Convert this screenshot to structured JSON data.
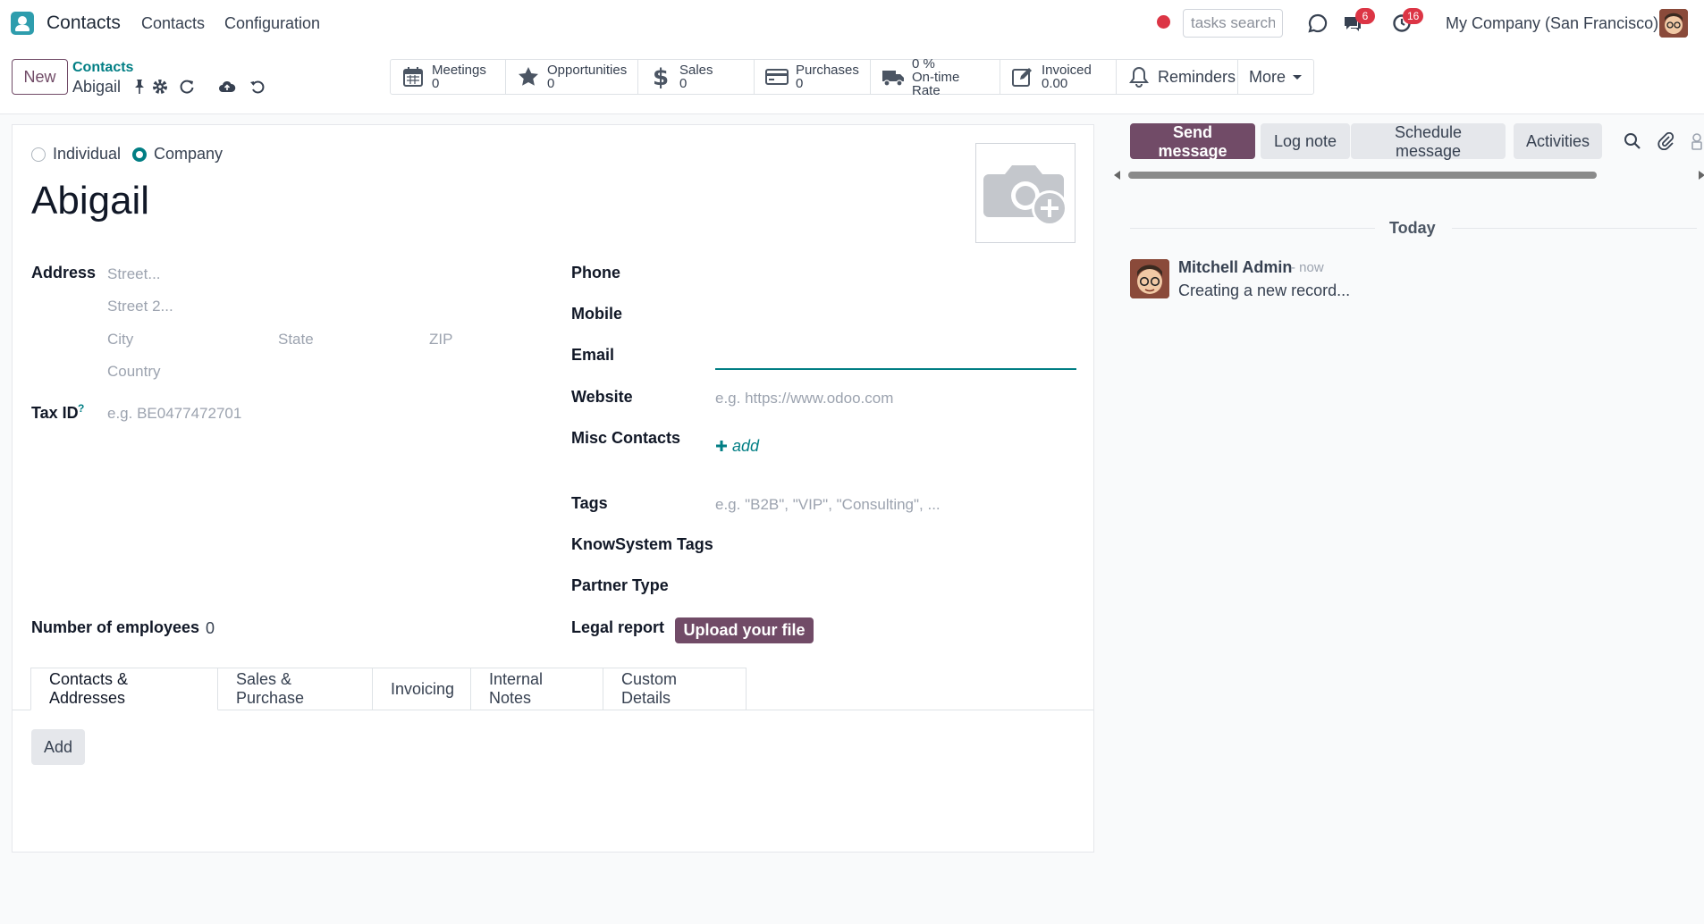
{
  "topbar": {
    "app_name": "Contacts",
    "menu": [
      "Contacts",
      "Configuration"
    ],
    "search_placeholder": "tasks search",
    "messages_count": "6",
    "activities_count": "16",
    "company": "My Company (San Francisco)"
  },
  "control": {
    "new_label": "New",
    "breadcrumb_parent": "Contacts",
    "breadcrumb_current": "Abigail"
  },
  "smart_buttons": {
    "meetings": {
      "label": "Meetings",
      "value": "0"
    },
    "opportunities": {
      "label": "Opportunities",
      "value": "0"
    },
    "sales": {
      "label": "Sales",
      "value": "0"
    },
    "purchases": {
      "label": "Purchases",
      "value": "0"
    },
    "ontime": {
      "value": "0 %",
      "label": "On-time Rate"
    },
    "invoiced": {
      "label": "Invoiced",
      "value": "0.00"
    },
    "reminders": "Reminders",
    "more": "More"
  },
  "form": {
    "type_individual": "Individual",
    "type_company": "Company",
    "name": "Abigail",
    "address_label": "Address",
    "street_ph": "Street...",
    "street2_ph": "Street 2...",
    "city_ph": "City",
    "state_ph": "State",
    "zip_ph": "ZIP",
    "country_ph": "Country",
    "taxid_label": "Tax ID",
    "taxid_help": "?",
    "taxid_ph": "e.g. BE0477472701",
    "employees_label": "Number of employees",
    "employees_value": "0",
    "phone_label": "Phone",
    "mobile_label": "Mobile",
    "email_label": "Email",
    "website_label": "Website",
    "website_ph": "e.g. https://www.odoo.com",
    "misc_label": "Misc Contacts",
    "misc_add": "add",
    "tags_label": "Tags",
    "tags_ph": "e.g. \"B2B\", \"VIP\", \"Consulting\", ...",
    "knowsystem_label": "KnowSystem Tags",
    "partner_type_label": "Partner Type",
    "legal_label": "Legal report",
    "upload_label": "Upload your file"
  },
  "tabs": [
    "Contacts & Addresses",
    "Sales & Purchase",
    "Invoicing",
    "Internal Notes",
    "Custom Details"
  ],
  "tab_add": "Add",
  "chatter": {
    "send_message": "Send message",
    "log_note": "Log note",
    "schedule_message": "Schedule message",
    "activities": "Activities",
    "day": "Today",
    "author": "Mitchell Admin",
    "time": "- now",
    "body": "Creating a new record..."
  },
  "colors": {
    "primary": "#714b67",
    "teal": "#017e84",
    "badge": "#dc3545"
  },
  "icons": [
    "app-logo-icon",
    "record-dot-icon",
    "chat-icon",
    "messages-icon",
    "clock-icon",
    "pin-icon",
    "gear-icon",
    "refresh-icon",
    "cloud-upload-icon",
    "undo-icon",
    "calendar-icon",
    "star-icon",
    "dollar-icon",
    "credit-card-icon",
    "truck-icon",
    "pencil-square-icon",
    "bell-icon",
    "caret-down-icon",
    "camera-plus-icon",
    "plus-icon",
    "search-icon",
    "paperclip-icon",
    "user-lock-icon"
  ]
}
